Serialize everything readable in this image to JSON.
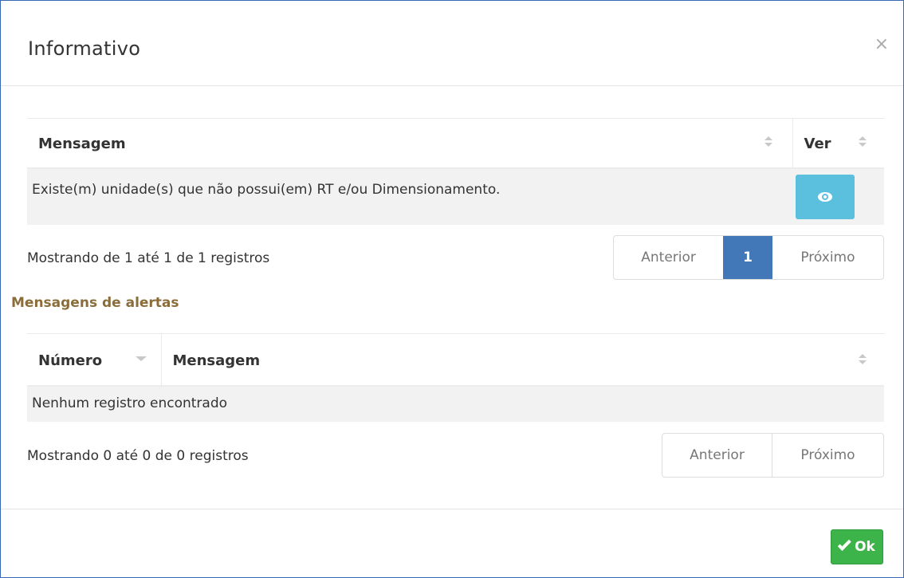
{
  "modal": {
    "title": "Informativo",
    "close_symbol": "×",
    "ok_label": "Ok",
    "ok_icon": "check-icon",
    "ok_color": "#3cb44a"
  },
  "messages_table": {
    "columns": [
      "Mensagem",
      "Ver"
    ],
    "rows": [
      {
        "message": "Existe(m) unidade(s) que não possui(em) RT e/ou Dimensionamento.",
        "action_icon": "eye-icon"
      }
    ],
    "info": "Mostrando de 1 até 1 de 1 registros",
    "pagination": {
      "prev": "Anterior",
      "current": "1",
      "next": "Próximo"
    },
    "accent_color": "#5bc0de"
  },
  "alerts_section": {
    "title": "Mensagens de alertas",
    "columns": [
      "Número",
      "Mensagem"
    ],
    "empty_text": "Nenhum registro encontrado",
    "info": "Mostrando 0 até 0 de 0 registros",
    "pagination": {
      "prev": "Anterior",
      "next": "Próximo"
    }
  }
}
